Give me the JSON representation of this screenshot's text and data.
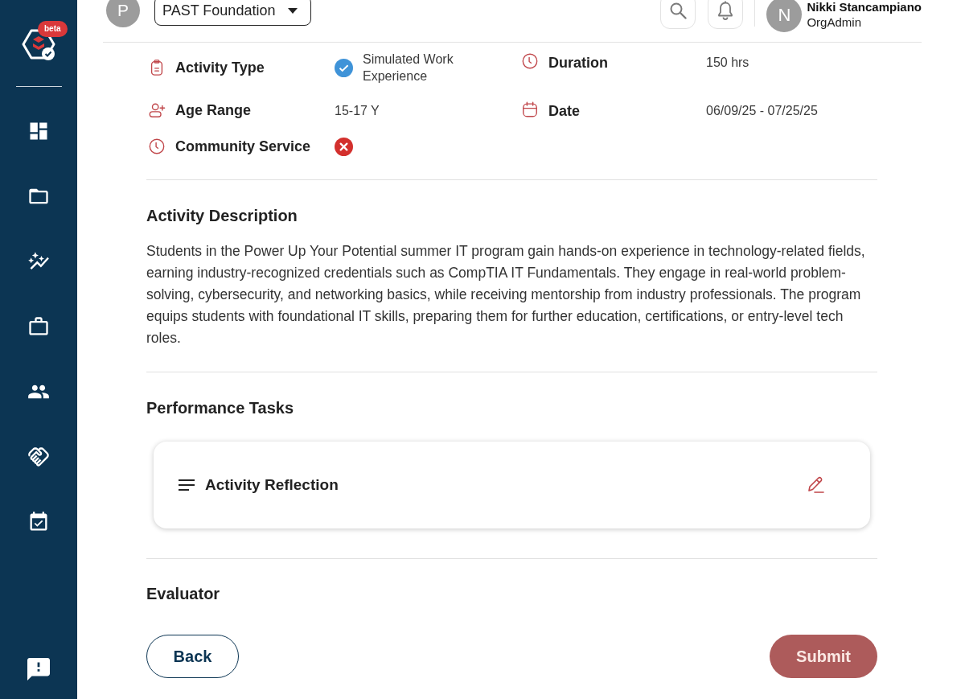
{
  "header": {
    "organization": {
      "avatar": "P",
      "name": "PAST Foundation"
    },
    "user": {
      "avatar": "N",
      "name": "Nikki Stancampiano",
      "role": "OrgAdmin"
    }
  },
  "sidebar": {
    "badge": "beta"
  },
  "details": [
    {
      "kind": "type",
      "label": "Activity Type",
      "value": "Simulated Work Experience"
    },
    {
      "kind": "duration",
      "label": "Duration",
      "value": "150 hrs"
    },
    {
      "kind": "age",
      "label": "Age Range",
      "value": "15-17 Y"
    },
    {
      "kind": "date",
      "label": "Date",
      "value": "06/09/25 - 07/25/25"
    },
    {
      "kind": "flag",
      "label": "Community Service",
      "on": false
    }
  ],
  "description": {
    "title": "Activity Description",
    "text": "Students in the Power Up Your Potential summer IT program gain hands-on experience in technology-related fields, earning industry-recognized credentials such as CompTIA IT Fundamentals. They engage in real-world problem-solving, cybersecurity, and networking basics, while receiving mentorship from industry professionals. The program equips students with foundational IT skills, preparing them for further education, certifications, or entry-level tech roles."
  },
  "performance_tasks": {
    "title": "Performance Tasks",
    "tasks": [
      {
        "title": "Activity Reflection"
      }
    ]
  },
  "evaluator": {
    "title": "Evaluator"
  },
  "buttons": [
    {
      "kind": "secondary",
      "label": "Back"
    },
    {
      "kind": "primary",
      "label": "Submit"
    }
  ]
}
